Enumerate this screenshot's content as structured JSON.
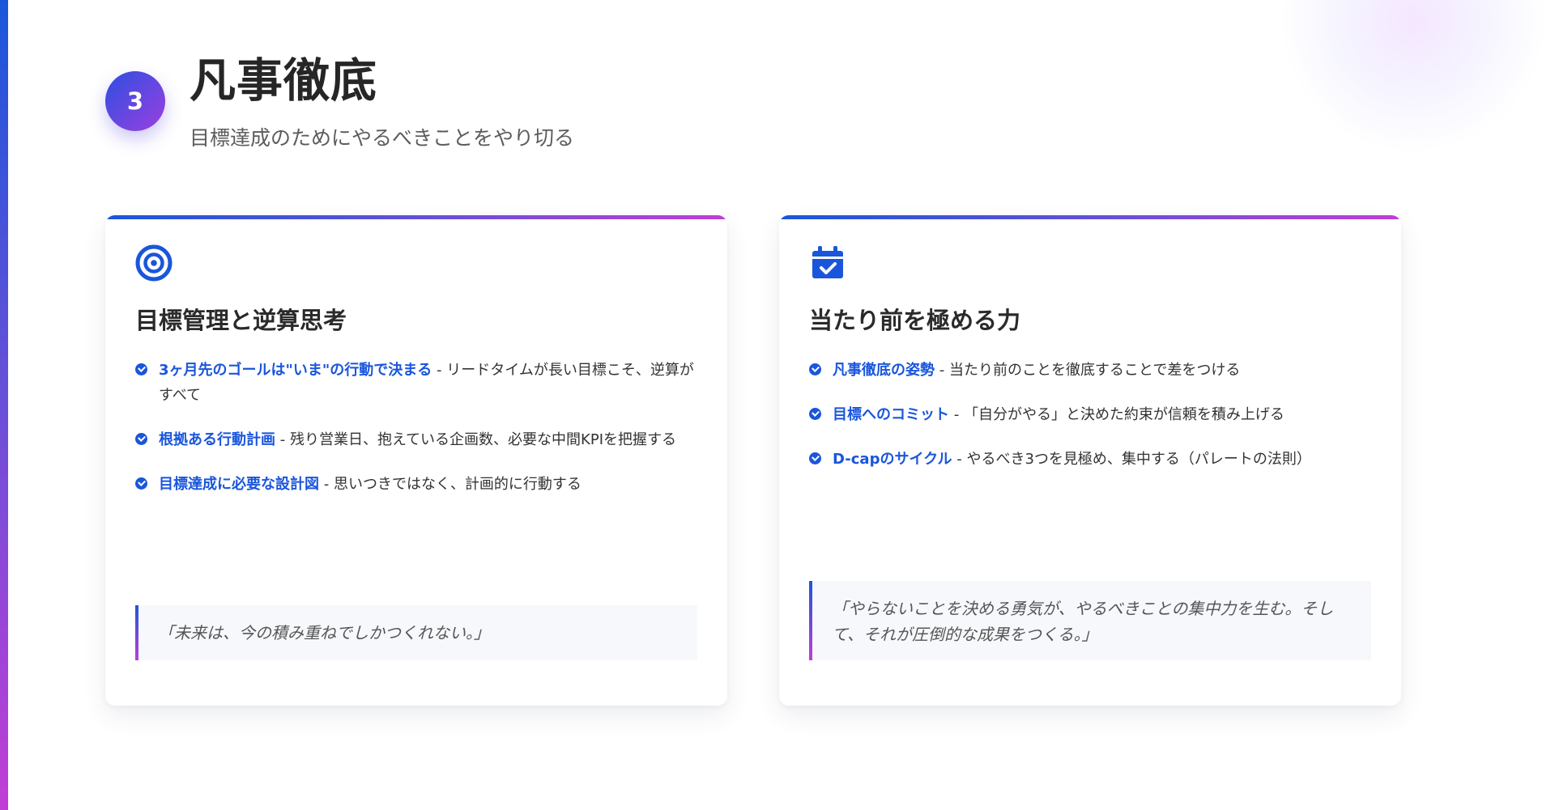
{
  "header": {
    "step_number": "3",
    "title": "凡事徹底",
    "subtitle": "目標達成のためにやるべきことをやり切る"
  },
  "colors": {
    "accent_blue": "#1a56db",
    "accent_purple": "#c03ed6"
  },
  "cards": [
    {
      "icon": "target-icon",
      "title": "目標管理と逆算思考",
      "bullets": [
        {
          "key": "3ヶ月先のゴールは\"いま\"の行動で決まる",
          "text": " - リードタイムが長い目標こそ、逆算がすべて"
        },
        {
          "key": "根拠ある行動計画",
          "text": " - 残り営業日、抱えている企画数、必要な中間KPIを把握する"
        },
        {
          "key": "目標達成に必要な設計図",
          "text": " - 思いつきではなく、計画的に行動する"
        }
      ],
      "quote": "「未来は、今の積み重ねでしかつくれない。」"
    },
    {
      "icon": "calendar-check-icon",
      "title": "当たり前を極める力",
      "bullets": [
        {
          "key": "凡事徹底の姿勢",
          "text": " - 当たり前のことを徹底することで差をつける"
        },
        {
          "key": "目標へのコミット",
          "text": " - 「自分がやる」と決めた約束が信頼を積み上げる"
        },
        {
          "key": "D-capのサイクル",
          "text": " - やるべき3つを見極め、集中する（パレートの法則）"
        }
      ],
      "quote": "「やらないことを決める勇気が、やるべきことの集中力を生む。そして、それが圧倒的な成果をつくる。」"
    }
  ]
}
